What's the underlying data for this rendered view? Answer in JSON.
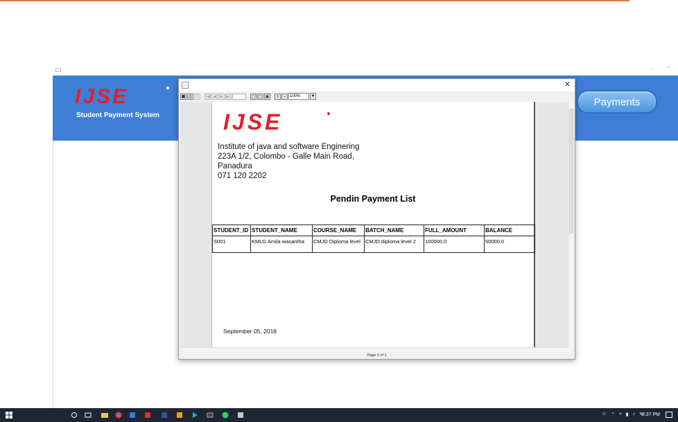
{
  "app": {
    "logo_text": "IJSE",
    "subtitle": "Student Payment System",
    "payments_label": "Payments",
    "min_glyph": "–",
    "max_glyph": "⌃"
  },
  "viewer": {
    "close_glyph": "✕",
    "zoom_value": "100%",
    "status": "Page 1 of 1"
  },
  "report": {
    "logo_text": "IJSE",
    "address_line1": "Institute of java and software Enginering",
    "address_line2": "223A 1/2, Colombo - Galle Main Road,",
    "address_line3": "Panadura",
    "phone": "071 120 2202",
    "title": "Pendin Payment List",
    "columns": [
      "STUDENT_ID",
      "STUDENT_NAME",
      "COURSE_NAME",
      "BATCH_NAME",
      "FULL_AMOUNT",
      "BALANCE"
    ],
    "rows": [
      [
        "S001",
        "KMLG Amila wasantha",
        "CMJD Diploma level",
        "CMJD diploma level 2",
        "100000.0",
        "50000.0"
      ]
    ],
    "date": "September 05, 2018"
  },
  "taskbar": {
    "clock": "8:37 PM"
  },
  "colors": {
    "header_blue": "#3f7ed6",
    "logo_red": "#e0202a",
    "accent_orange": "#e07a3c",
    "taskbar": "#1f2533"
  }
}
